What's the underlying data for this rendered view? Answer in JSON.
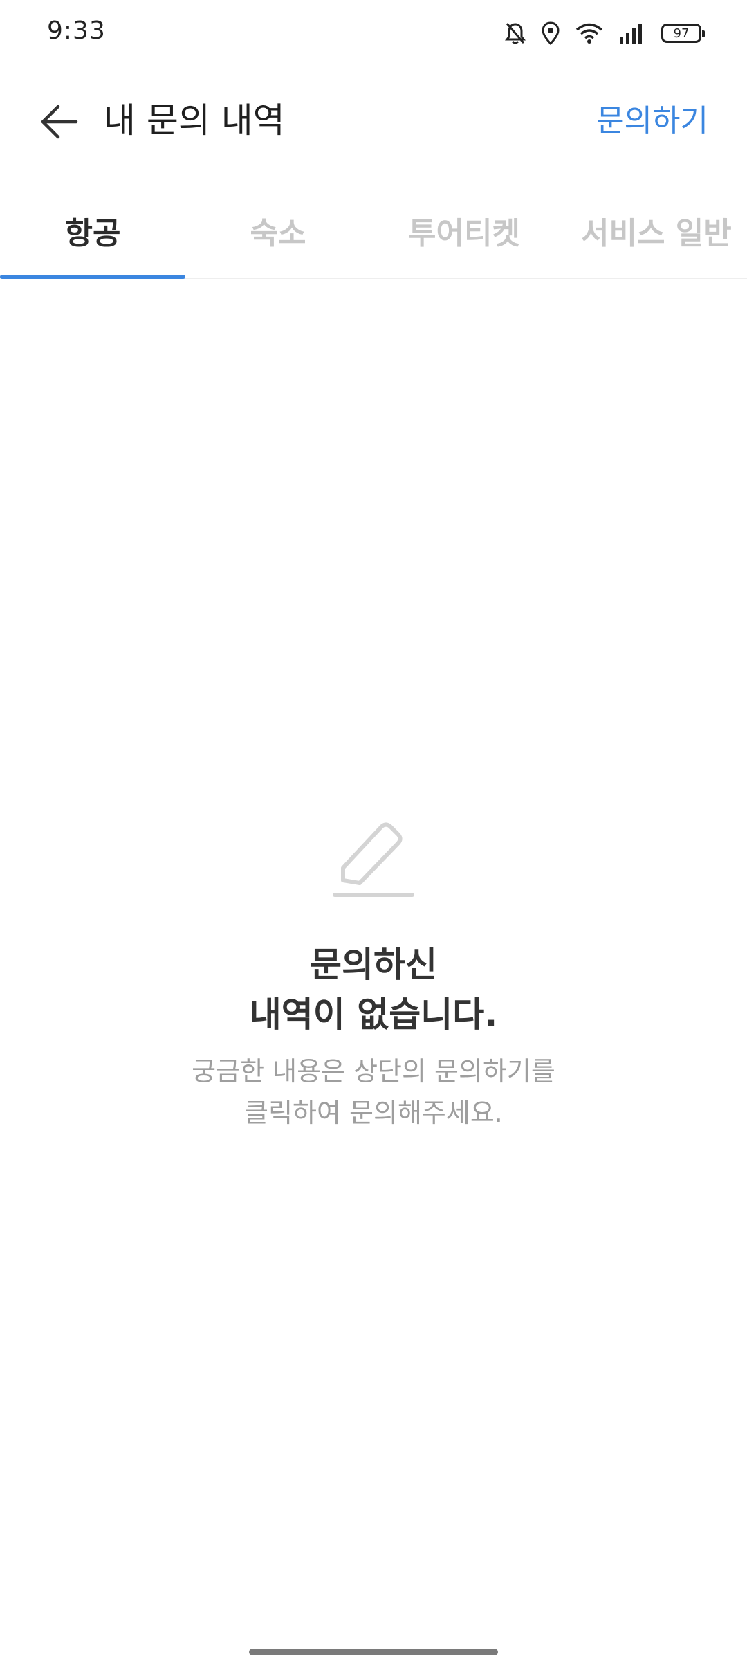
{
  "status_bar": {
    "time": "9:33",
    "battery": "97",
    "icons": [
      "bell-off-icon",
      "location-icon",
      "wifi-icon",
      "signal-icon",
      "battery-icon"
    ]
  },
  "app_bar": {
    "title": "내 문의 내역",
    "action_label": "문의하기",
    "back_icon": "arrow-left-icon",
    "accent_color": "#3b86e0"
  },
  "tabs": [
    {
      "label": "항공",
      "active": true
    },
    {
      "label": "숙소",
      "active": false
    },
    {
      "label": "투어티켓",
      "active": false
    },
    {
      "label": "서비스 일반",
      "active": false
    }
  ],
  "empty_state": {
    "icon": "pencil-icon",
    "title_line1": "문의하신",
    "title_line2": "내역이 없습니다.",
    "desc_line1": "궁금한 내용은 상단의 문의하기를",
    "desc_line2": "클릭하여 문의해주세요."
  }
}
